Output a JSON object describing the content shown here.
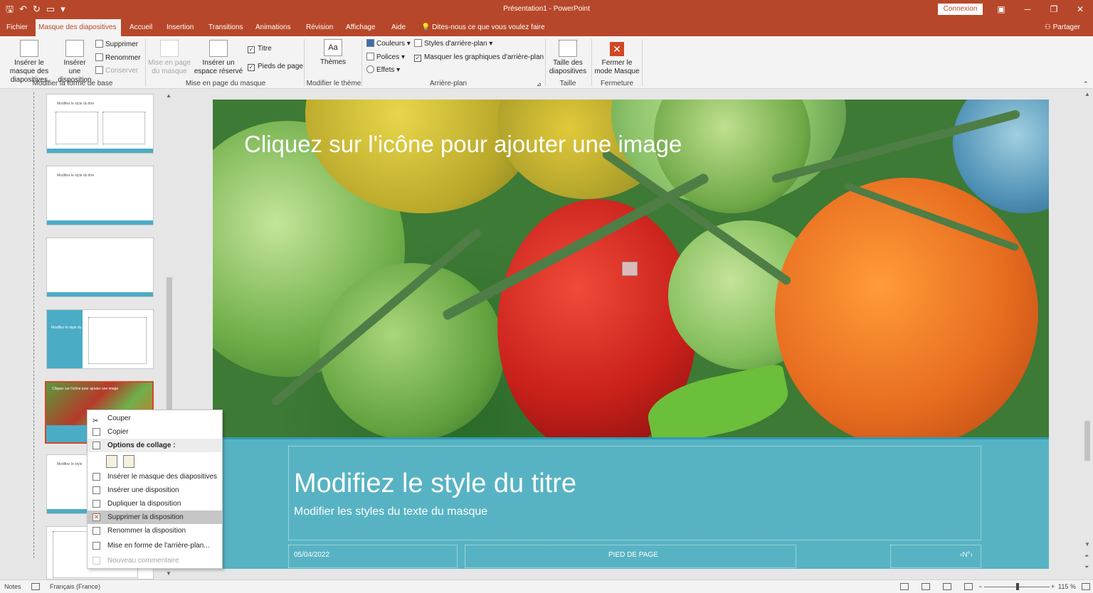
{
  "title_bar": {
    "doc_title": "Présentation1  -  PowerPoint",
    "connexion": "Connexion",
    "qat": [
      "save-icon",
      "undo-icon",
      "redo-icon",
      "present-icon",
      "customize-icon"
    ]
  },
  "tabs": [
    {
      "label": "Fichier"
    },
    {
      "label": "Masque des diapositives"
    },
    {
      "label": "Accueil"
    },
    {
      "label": "Insertion"
    },
    {
      "label": "Transitions"
    },
    {
      "label": "Animations"
    },
    {
      "label": "Révision"
    },
    {
      "label": "Affichage"
    },
    {
      "label": "Aide"
    },
    {
      "label": "Dites-nous ce que vous voulez faire"
    }
  ],
  "share": "Partager",
  "ribbon": {
    "insert_master": "Insérer le masque des diapositives",
    "insert_layout": "Insérer une disposition",
    "delete": "Supprimer",
    "rename": "Renommer",
    "preserve": "Conserver",
    "group1": "Modifier la forme de base",
    "master_layout": "Mise en page du masque",
    "insert_placeholder": "Insérer un espace réservé",
    "title_cb": "Titre",
    "footers_cb": "Pieds de page",
    "group2": "Mise en page du masque",
    "themes": "Thèmes",
    "group3": "Modifier le thème",
    "colors": "Couleurs",
    "fonts": "Polices",
    "effects": "Effets",
    "bg_styles": "Styles d'arrière-plan",
    "hide_bg": "Masquer les graphiques d'arrière-plan",
    "group4": "Arrière-plan",
    "slide_size": "Taille des diapositives",
    "group5": "Taille",
    "close_master": "Fermer le mode Masque",
    "group6": "Fermeture"
  },
  "thumbs": [
    {
      "label": "Modifiez le style du titre"
    },
    {
      "label": "Modifiez le style du titre"
    },
    {
      "label": ""
    },
    {
      "label": "Modifiez le style du titre"
    },
    {
      "label": "Cliquez sur l'icône pour ajouter une image"
    },
    {
      "label": "Modifiez le style"
    }
  ],
  "slide": {
    "photo_caption": "Cliquez sur l'icône pour ajouter une image",
    "title": "Modifiez le style du titre",
    "subtitle": "Modifier les styles du texte du masque",
    "date": "05/04/2022",
    "footer": "PIED DE PAGE",
    "number": "‹N°›"
  },
  "context_menu": {
    "cut": "Couper",
    "copy": "Copier",
    "paste_options": "Options de collage :",
    "insert_master": "Insérer le masque des diapositives",
    "insert_layout": "Insérer une disposition",
    "duplicate_layout": "Dupliquer la disposition",
    "delete_layout": "Supprimer la disposition",
    "rename_layout": "Renommer la disposition",
    "format_bg": "Mise en forme de l'arrière-plan...",
    "new_comment": "Nouveau commentaire"
  },
  "status_bar": {
    "notes": "Notes",
    "language": "Français (France)",
    "zoom": "115 %"
  },
  "colors": {
    "accent": "#b7472a",
    "teal": "#57b3c3"
  }
}
